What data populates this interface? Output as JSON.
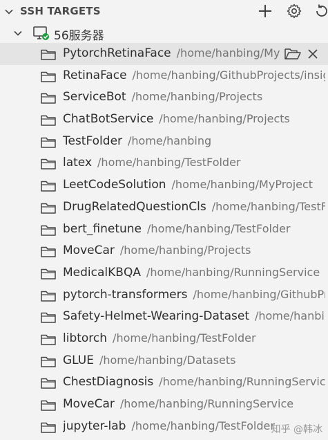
{
  "section": {
    "title": "SSH TARGETS"
  },
  "toolbar": {
    "add_icon": "plus-icon",
    "settings_icon": "gear-icon",
    "refresh_icon": "refresh-icon"
  },
  "host": {
    "label": "56服务器",
    "status_color": "#1e9e3e"
  },
  "selected_actions": {
    "open_icon": "open-folder-icon",
    "close_icon": "close-icon"
  },
  "folders": [
    {
      "name": "PytorchRetinaFace",
      "path": "/home/hanbing/MyProject"
    },
    {
      "name": "RetinaFace",
      "path": "/home/hanbing/GithubProjects/insightface"
    },
    {
      "name": "ServiceBot",
      "path": "/home/hanbing/Projects"
    },
    {
      "name": "ChatBotService",
      "path": "/home/hanbing/Projects"
    },
    {
      "name": "TestFolder",
      "path": "/home/hanbing"
    },
    {
      "name": "latex",
      "path": "/home/hanbing/TestFolder"
    },
    {
      "name": "LeetCodeSolution",
      "path": "/home/hanbing/MyProject"
    },
    {
      "name": "DrugRelatedQuestionCls",
      "path": "/home/hanbing/TestFolder"
    },
    {
      "name": "bert_finetune",
      "path": "/home/hanbing/TestFolder"
    },
    {
      "name": "MoveCar",
      "path": "/home/hanbing/Projects"
    },
    {
      "name": "MedicalKBQA",
      "path": "/home/hanbing/RunningService"
    },
    {
      "name": "pytorch-transformers",
      "path": "/home/hanbing/GithubProjects"
    },
    {
      "name": "Safety-Helmet-Wearing-Dataset",
      "path": "/home/hanbing/GithubProjects"
    },
    {
      "name": "libtorch",
      "path": "/home/hanbing/TestFolder"
    },
    {
      "name": "GLUE",
      "path": "/home/hanbing/Datasets"
    },
    {
      "name": "ChestDiagnosis",
      "path": "/home/hanbing/RunningService"
    },
    {
      "name": "MoveCar",
      "path": "/home/hanbing/RunningService"
    },
    {
      "name": "jupyter-lab",
      "path": "/home/hanbing/TestFolder"
    }
  ],
  "watermark": "知乎 @韩冰"
}
